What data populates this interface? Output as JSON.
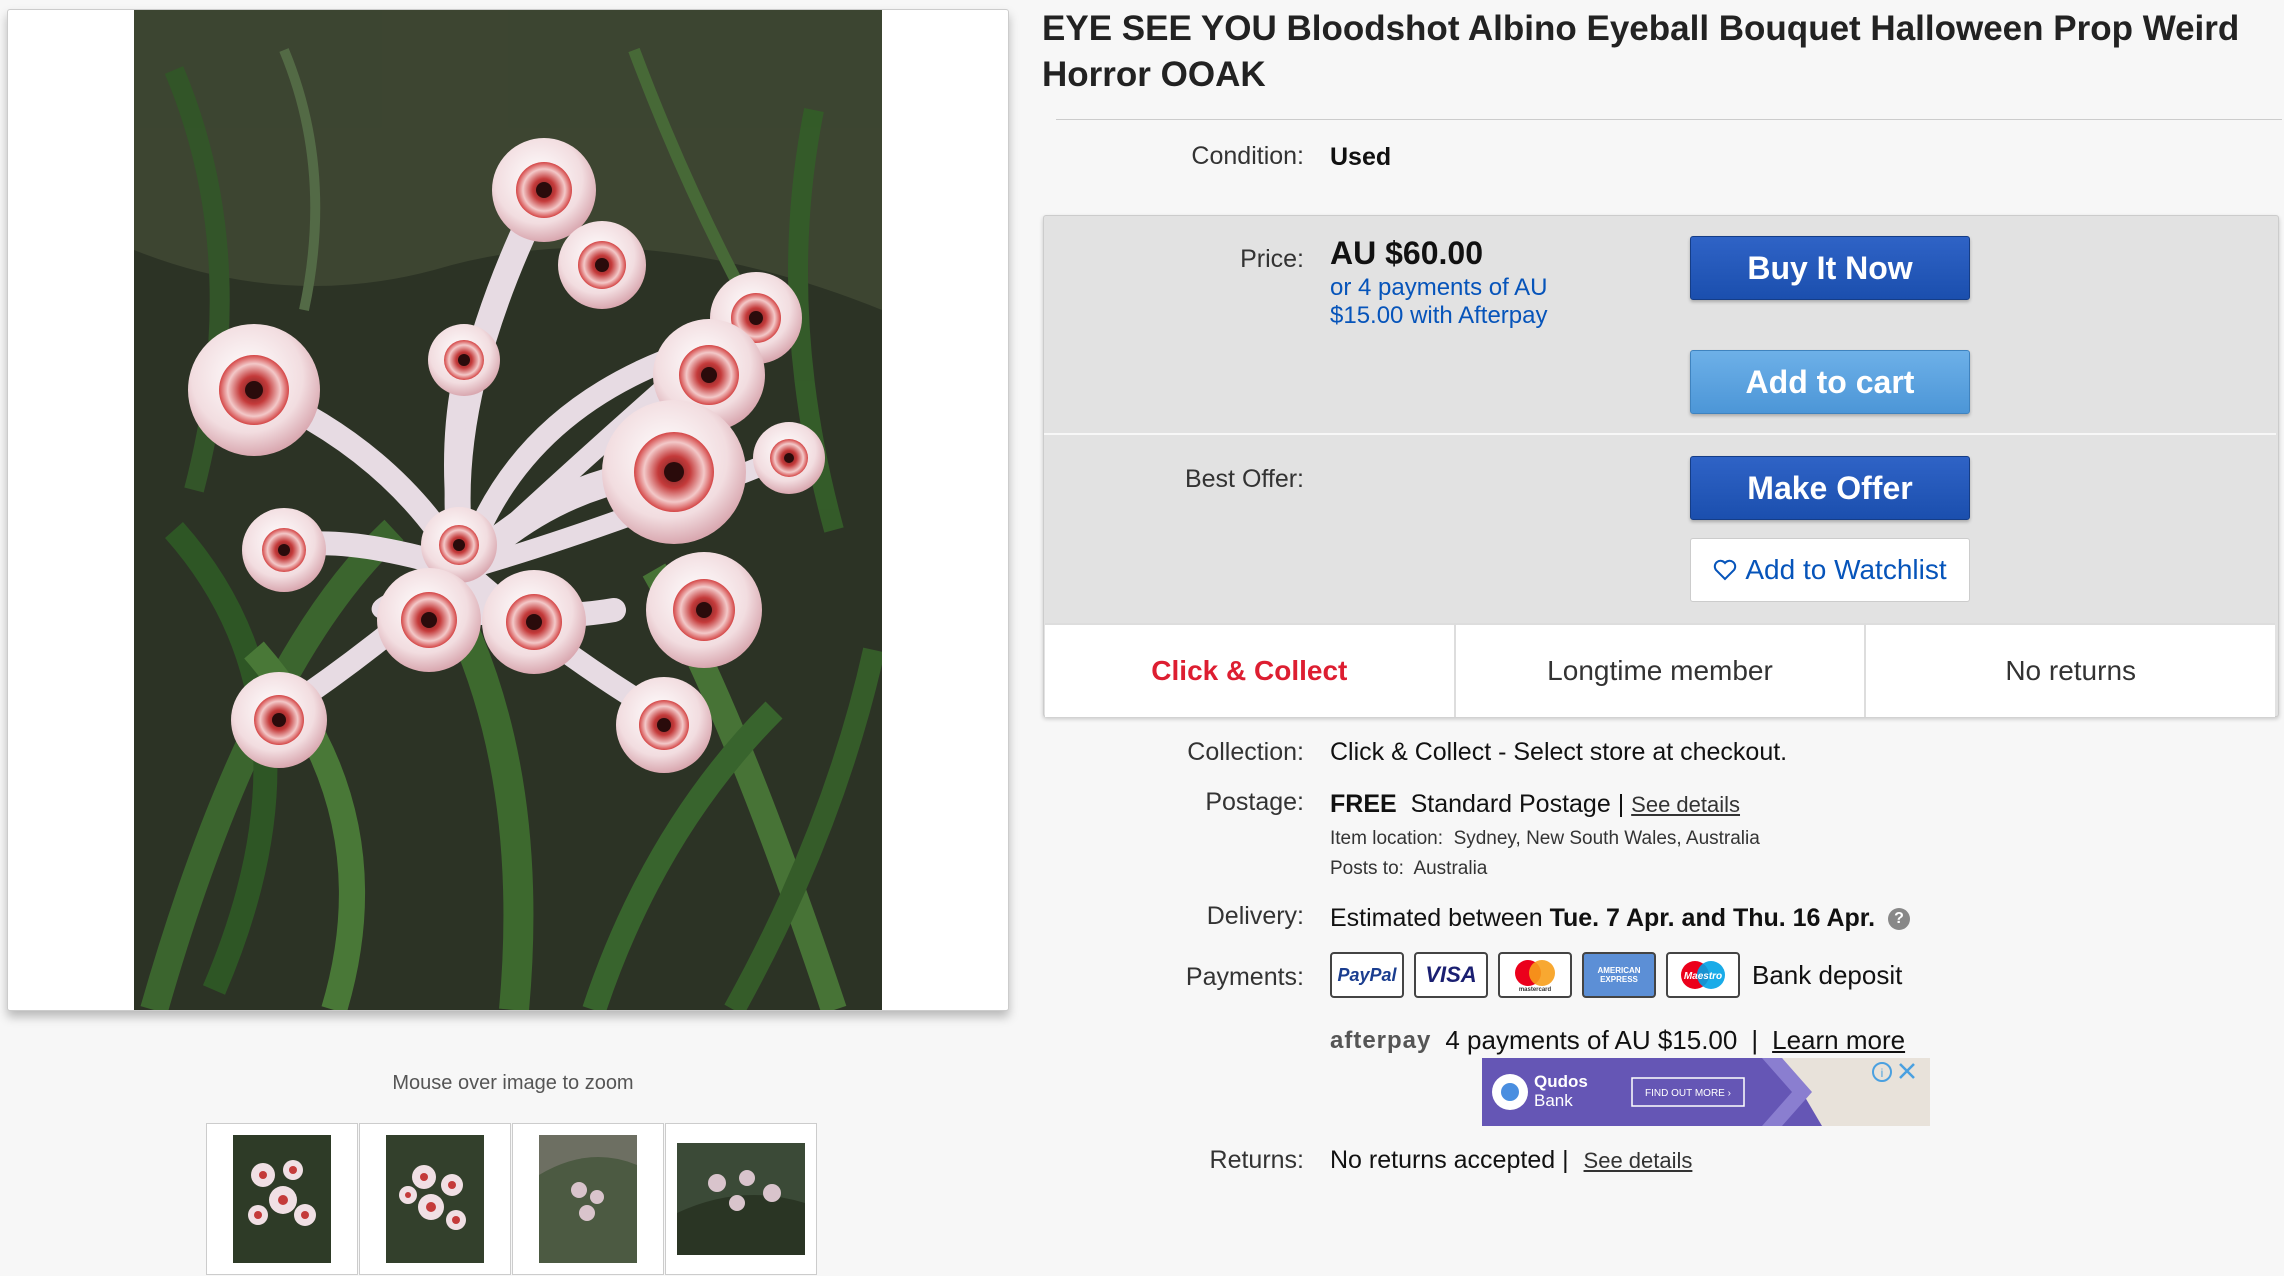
{
  "title": "EYE SEE YOU Bloodshot Albino Eyeball Bouquet Halloween Prop Weird Horror OOAK",
  "gallery": {
    "zoom_hint": "Mouse over image to zoom",
    "thumbnail_count": 4
  },
  "condition": {
    "label": "Condition:",
    "value": "Used"
  },
  "price": {
    "label": "Price:",
    "value": "AU $60.00",
    "afterpay_note": "or 4 payments of AU $15.00 with Afterpay"
  },
  "buttons": {
    "buy_now": "Buy It Now",
    "add_to_cart": "Add to cart",
    "make_offer": "Make Offer",
    "watchlist": "Add to Watchlist"
  },
  "best_offer": {
    "label": "Best Offer:"
  },
  "badges": [
    "Click & Collect",
    "Longtime member",
    "No returns"
  ],
  "collection": {
    "label": "Collection:",
    "value": "Click & Collect - Select store at checkout."
  },
  "postage": {
    "label": "Postage:",
    "free": "FREE",
    "service": "Standard Postage",
    "separator": "|",
    "see_details": "See details",
    "item_location_label": "Item location:",
    "item_location": "Sydney, New South Wales, Australia",
    "posts_to_label": "Posts to:",
    "posts_to": "Australia"
  },
  "delivery": {
    "label": "Delivery:",
    "prefix": "Estimated between",
    "range": "Tue. 7 Apr. and Thu. 16 Apr."
  },
  "payments": {
    "label": "Payments:",
    "methods": [
      "PayPal",
      "VISA",
      "mastercard",
      "AMERICAN EXPRESS",
      "Maestro"
    ],
    "bank_deposit": "Bank deposit"
  },
  "afterpay": {
    "logo": "afterpay",
    "text": "4 payments of AU $15.00",
    "separator": "|",
    "learn_more": "Learn more"
  },
  "ad": {
    "brand_line1": "Qudos",
    "brand_line2": "Bank",
    "cta": "FIND OUT MORE ›"
  },
  "returns": {
    "label": "Returns:",
    "value": "No returns accepted",
    "separator": "|",
    "see_details": "See details"
  },
  "colors": {
    "primary_button": "#1b4fae",
    "secondary_button": "#4c96d7",
    "link": "#0654ba",
    "badge_red": "#dd1e31"
  }
}
